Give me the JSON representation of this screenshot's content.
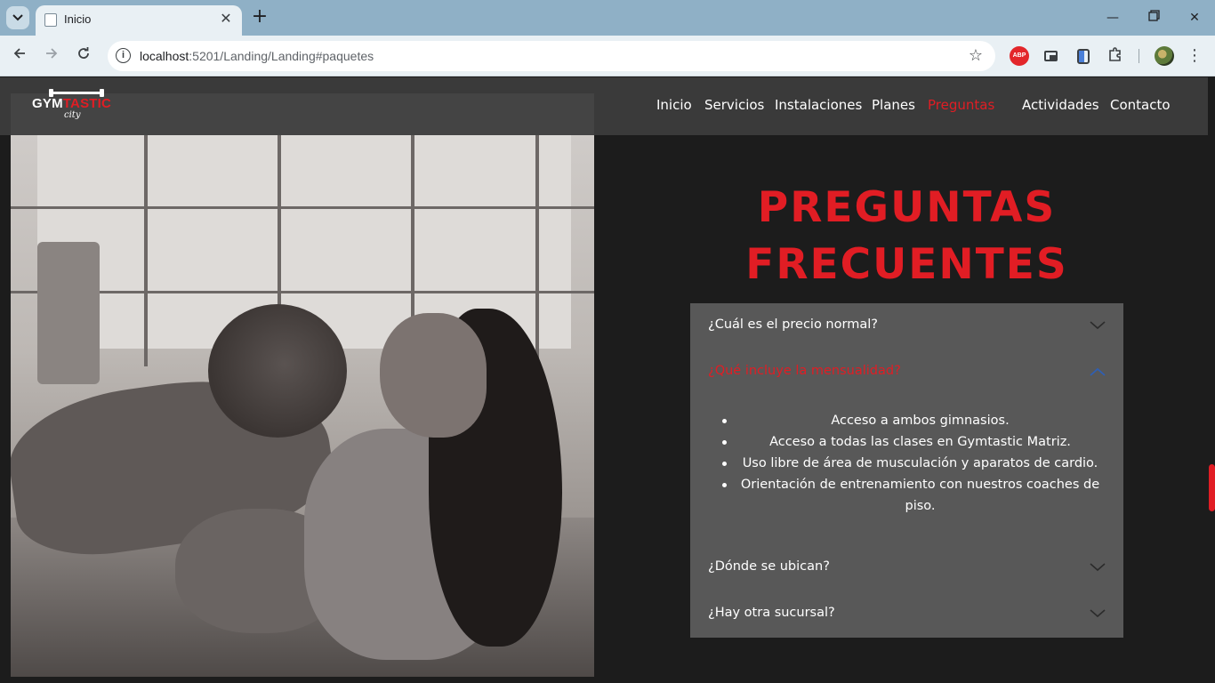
{
  "browser": {
    "tab_title": "Inicio",
    "url_host": "localhost",
    "url_rest": ":5201/Landing/Landing#paquetes",
    "abp_label": "ABP"
  },
  "site": {
    "logo": {
      "text_white": "GYM",
      "text_red": "TASTIC",
      "sub": "city"
    },
    "nav": [
      {
        "label": "Inicio",
        "active": false
      },
      {
        "label": "Servicios",
        "active": false
      },
      {
        "label": "Instalaciones",
        "active": false
      },
      {
        "label": "Planes",
        "active": false
      },
      {
        "label": "Preguntas",
        "active": true
      },
      {
        "label": "Actividades",
        "active": false
      },
      {
        "label": "Contacto",
        "active": false
      }
    ],
    "colors": {
      "accent": "#e11d24",
      "header_bg": "#3a3a3a",
      "faq_bg": "#585858",
      "page_bg": "#1c1c1c"
    }
  },
  "faq": {
    "title_line1": "PREGUNTAS",
    "title_line2": "FRECUENTES",
    "items": [
      {
        "question": "¿Cuál es el precio normal?",
        "open": false
      },
      {
        "question": "¿Qué incluye la mensualidad?",
        "open": true
      },
      {
        "question": "¿Dónde se ubican?",
        "open": false
      },
      {
        "question": "¿Hay otra sucursal?",
        "open": false
      }
    ],
    "answer": [
      "Acceso a ambos gimnasios.",
      "Acceso a todas las clases en Gymtastic Matriz.",
      "Uso libre de área de musculación y aparatos de cardio.",
      "Orientación de entrenamiento con nuestros coaches de piso."
    ]
  }
}
